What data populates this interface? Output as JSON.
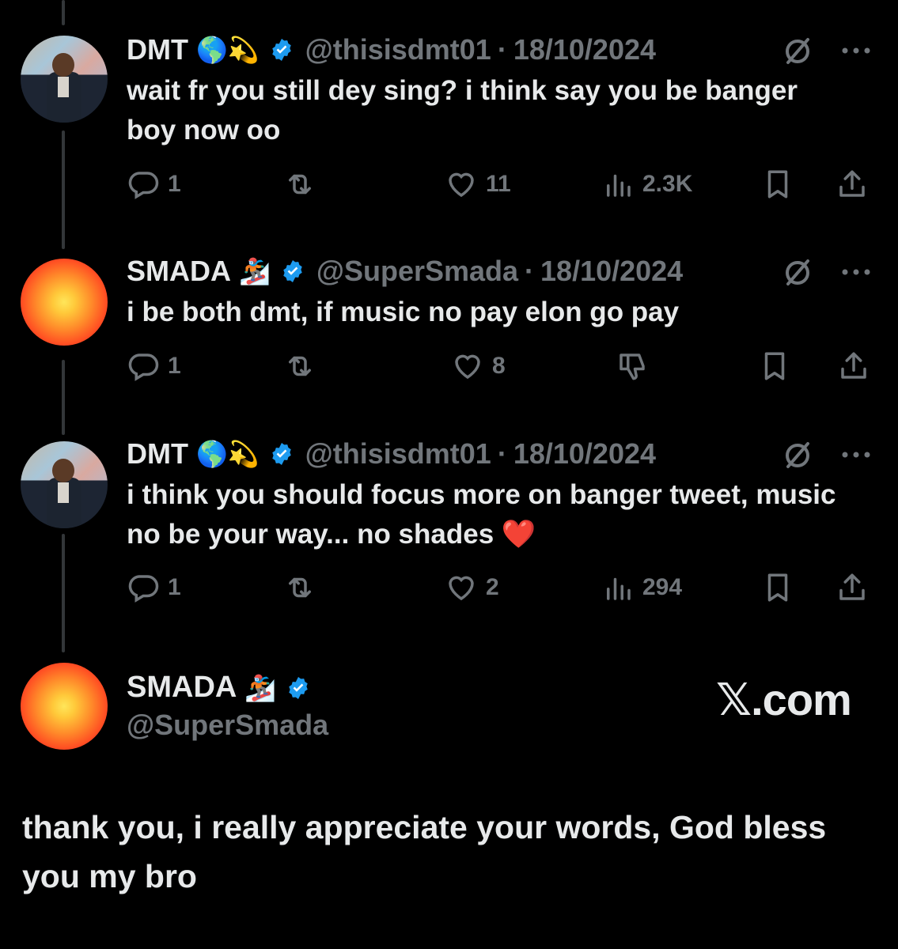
{
  "tweets": [
    {
      "name": "DMT",
      "emojis": "🌎💫",
      "handle": "@thisisdmt01",
      "separator": "·",
      "date": "18/10/2024",
      "text": "wait fr you still dey sing? i think say you be banger boy now oo",
      "replies": "1",
      "likes": "11",
      "views": "2.3K",
      "avatar": "dmt-photo"
    },
    {
      "name": "SMADA",
      "emojis": "🏂",
      "handle": "@SuperSmada",
      "separator": "·",
      "date": "18/10/2024",
      "text": "i be both dmt, if music no pay elon go pay",
      "replies": "1",
      "likes": "8",
      "avatar": "smada-orb"
    },
    {
      "name": "DMT",
      "emojis": "🌎💫",
      "handle": "@thisisdmt01",
      "separator": "·",
      "date": "18/10/2024",
      "text": "i think you should focus more on banger tweet, music no be your way... no shades ❤️",
      "replies": "1",
      "likes": "2",
      "views": "294",
      "avatar": "dmt-photo"
    }
  ],
  "compose": {
    "name": "SMADA",
    "emojis": "🏂",
    "handle": "@SuperSmada",
    "brand": "𝕏.com",
    "text": "thank you, i really appreciate your words, God bless you my bro"
  },
  "colors": {
    "background": "#000000",
    "text": "#e7e9ea",
    "muted": "#71767b",
    "verified": "#1d9bf0"
  }
}
